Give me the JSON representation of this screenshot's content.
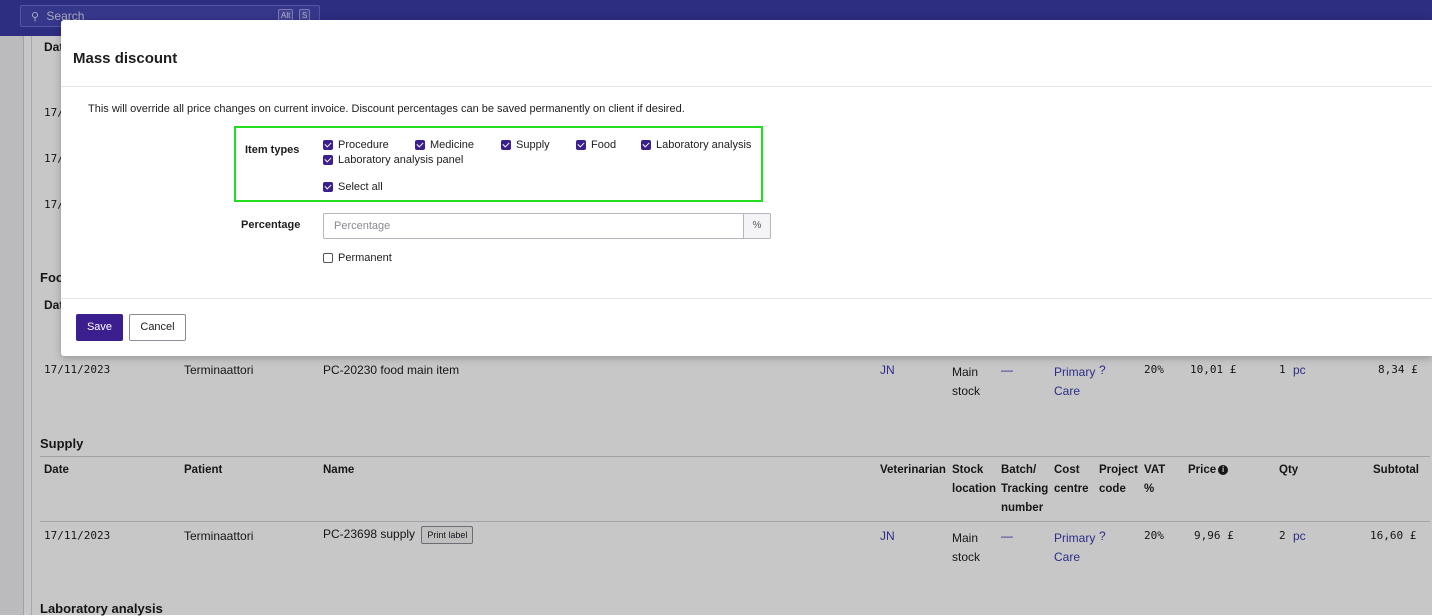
{
  "topbar": {
    "search_placeholder": "Search",
    "shortcut_keys": [
      "Alt",
      "S"
    ]
  },
  "background": {
    "partial_date_header": "Dat",
    "partial_dates": [
      "17/",
      "17/",
      "17/"
    ],
    "food_section_partial": "Foo",
    "food_date_header_partial": "Dat",
    "food_row": {
      "date": "17/11/2023",
      "patient": "Terminaattori",
      "name": "PC-20230 food main item",
      "veterinarian": "JN",
      "stock_location": "Main stock",
      "batch": "—",
      "cost_centre": "Primary Care",
      "project_code": "?",
      "vat": "20%",
      "price": "10,01 £",
      "qty": "1",
      "unit": "pc",
      "subtotal": "8,34 £"
    },
    "supply_section": {
      "title": "Supply",
      "headers": {
        "date": "Date",
        "patient": "Patient",
        "name": "Name",
        "veterinarian": "Veterinarian",
        "stock_location": "Stock location",
        "batch": "Batch/ Tracking number",
        "cost_centre": "Cost centre",
        "project_code": "Project code",
        "vat": "VAT %",
        "price": "Price",
        "qty": "Qty",
        "subtotal": "Subtotal"
      },
      "row": {
        "date": "17/11/2023",
        "patient": "Terminaattori",
        "name": "PC-23698 supply",
        "print_label": "Print label",
        "veterinarian": "JN",
        "stock_location": "Main stock",
        "batch": "—",
        "cost_centre": "Primary Care",
        "project_code": "?",
        "vat": "20%",
        "price": "9,96 £",
        "qty": "2",
        "unit": "pc",
        "subtotal": "16,60 £"
      }
    },
    "lab_section_title": "Laboratory analysis"
  },
  "modal": {
    "title": "Mass discount",
    "description": "This will override all price changes on current invoice. Discount percentages can be saved permanently on client if desired.",
    "item_types_label": "Item types",
    "item_types": [
      {
        "label": "Procedure",
        "checked": true
      },
      {
        "label": "Medicine",
        "checked": true
      },
      {
        "label": "Supply",
        "checked": true
      },
      {
        "label": "Food",
        "checked": true
      },
      {
        "label": "Laboratory analysis",
        "checked": true
      },
      {
        "label": "Laboratory analysis panel",
        "checked": true
      }
    ],
    "select_all_label": "Select all",
    "percentage_label": "Percentage",
    "percentage_placeholder": "Percentage",
    "percentage_value": "",
    "percent_symbol": "%",
    "permanent_label": "Permanent",
    "permanent_checked": false,
    "save_label": "Save",
    "cancel_label": "Cancel"
  },
  "colors": {
    "topbar": "#3a3aa6",
    "primary_button": "#3b1f8f",
    "checkbox": "#3b1f8f",
    "highlight": "#22dd22",
    "link": "#3a3ab0"
  }
}
